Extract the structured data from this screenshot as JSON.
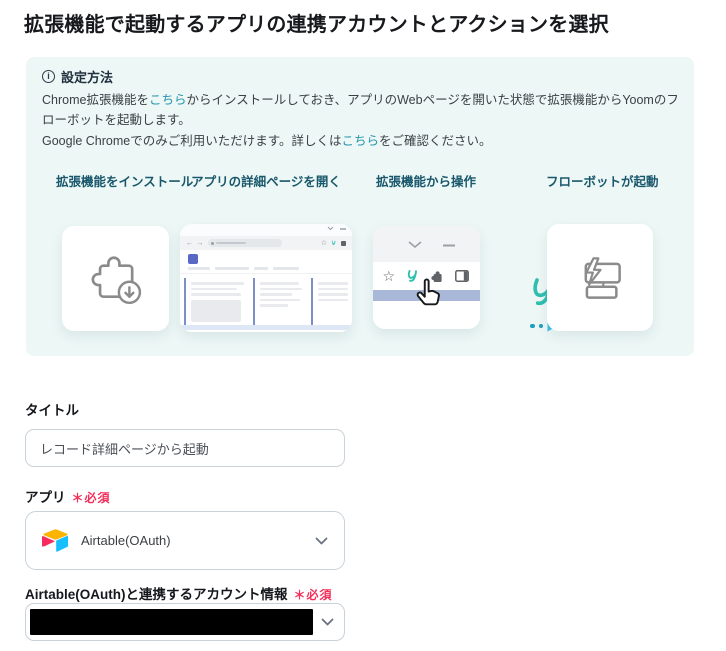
{
  "page": {
    "title": "拡張機能で起動するアプリの連携アカウントとアクションを選択"
  },
  "guide": {
    "header": "設定方法",
    "line1": {
      "pre": "Chrome拡張機能を",
      "link": "こちら",
      "post": "からインストールしておき、アプリのWebページを開いた状態で拡張機能からYoomのフローボットを起動します。"
    },
    "line2": {
      "pre": "Google Chromeでのみご利用いただけます。詳しくは",
      "link": "こちら",
      "post": "をご確認ください。"
    },
    "steps": [
      {
        "label": "拡張機能をインストール",
        "icon": "puzzle-download-icon"
      },
      {
        "label": "アプリの詳細ページを開く",
        "icon": "browser-page-illustration"
      },
      {
        "label": "拡張機能から操作",
        "icon": "extension-toolbar-illustration"
      },
      {
        "label": "フローボットが起動",
        "icon": "flowbot-icon"
      }
    ]
  },
  "form": {
    "title_field": {
      "label": "タイトル",
      "value": "レコード詳細ページから起動"
    },
    "app_field": {
      "label": "アプリ",
      "required_mark": "＊",
      "required_text": "必須",
      "value": "Airtable(OAuth)",
      "app_icon": "airtable-logo"
    },
    "account_field": {
      "label": "Airtable(OAuth)と連携するアカウント情報",
      "required_mark": "＊",
      "required_text": "必須",
      "value_state": "redacted"
    }
  },
  "colors": {
    "panel_bg": "#edf7f5",
    "step_title": "#19586c",
    "link": "#2596ad",
    "required_red": "#f1305a",
    "brand_teal": "#2fbfb0",
    "arrow_cyan": "#41bdeb",
    "airtable_yellow": "#fcb400",
    "airtable_blue": "#18bfff",
    "airtable_red": "#f82b60"
  }
}
